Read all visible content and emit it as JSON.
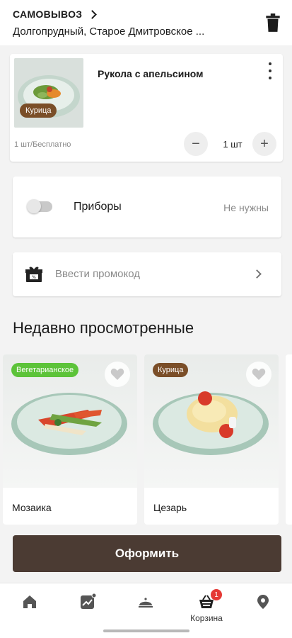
{
  "header": {
    "mode_label": "САМОВЫВОЗ",
    "address": "Долгопрудный, Старое Дмитровское ..."
  },
  "cart_item": {
    "tag": "Курица",
    "tag_color": "#7a4e28",
    "title": "Рукола с апельсином",
    "price_info": "1 шт/Бесплатно",
    "quantity": "1 шт",
    "minus": "−",
    "plus": "+"
  },
  "cutlery": {
    "label": "Приборы",
    "value": "Не нужны",
    "enabled": false
  },
  "promo": {
    "label": "Ввести промокод"
  },
  "recent": {
    "title": "Недавно просмотренные",
    "items": [
      {
        "tag": "Вегетарианское",
        "tag_color": "#5cc339",
        "name": "Мозаика"
      },
      {
        "tag": "Курица",
        "tag_color": "#7a4e28",
        "name": "Цезарь"
      }
    ]
  },
  "checkout": {
    "label": "Оформить",
    "color": "#4b3b33"
  },
  "nav": {
    "items": [
      {
        "icon": "home-icon",
        "label": ""
      },
      {
        "icon": "trending-icon",
        "label": ""
      },
      {
        "icon": "cloche-icon",
        "label": ""
      },
      {
        "icon": "basket-icon",
        "label": "Корзина",
        "badge": "1",
        "active": true
      },
      {
        "icon": "location-icon",
        "label": ""
      }
    ]
  }
}
